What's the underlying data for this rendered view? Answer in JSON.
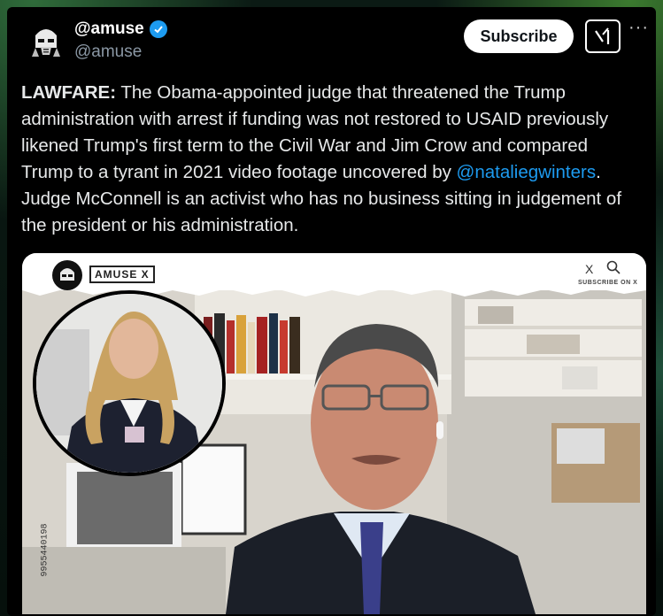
{
  "post": {
    "display_name": "@amuse",
    "handle": "@amuse",
    "subscribe_label": "Subscribe",
    "more_label": "···",
    "text_lead": "LAWFARE:",
    "text_part1": " The Obama-appointed judge that threatened the Trump administration with arrest if funding was not restored to USAID previously likened Trump's first term to the Civil War and Jim Crow and compared Trump to a tyrant in 2021 video footage uncovered by ",
    "mention": "@nataliegwinters",
    "text_part2": ". Judge McConnell is an activist who has no business sitting in judgement of the president or his administration."
  },
  "video": {
    "brand": "AMUSE X",
    "x_label": "X",
    "subscribe_caption": "SUBSCRIBE ON X",
    "side_code": "9955440198"
  },
  "colors": {
    "verified": "#1d9bf0",
    "mention": "#1d9bf0",
    "text": "#e7e9ea",
    "muted": "#8b98a5"
  },
  "icons": {
    "verified": "verified-badge-icon",
    "xai": "xai-grok-icon",
    "more": "more-options-icon",
    "search": "search-icon"
  }
}
